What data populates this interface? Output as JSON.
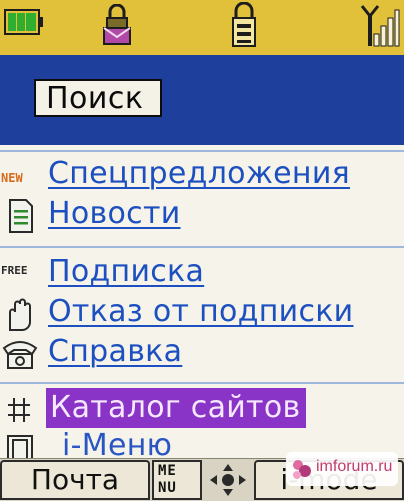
{
  "search": {
    "label": "Поиск"
  },
  "menu": {
    "items": [
      {
        "label": "Спецпредложения",
        "icon": "new-icon"
      },
      {
        "label": "Новости",
        "icon": "document-icon"
      },
      {
        "label": "Подписка",
        "icon": "free-icon"
      },
      {
        "label": "Отказ от подписки",
        "icon": "hand-icon"
      },
      {
        "label": "Справка",
        "icon": "telephone-icon"
      },
      {
        "label": "Каталог сайтов",
        "icon": "hash-icon",
        "selected": true
      },
      {
        "label": "i-Меню",
        "icon": "book-icon"
      }
    ],
    "icon_labels": {
      "new": "NEW",
      "free": "FREE"
    }
  },
  "softkeys": {
    "left": "Почта",
    "menu_glyph": [
      "ME",
      "NU"
    ],
    "right": "i-mode"
  },
  "watermark": "imforum.ru",
  "colors": {
    "status_bar": "#e2c13a",
    "title_band": "#1f3f9c",
    "link": "#1c4fc0",
    "selection": "#8a34c7",
    "battery": "#2fae2f",
    "separator": "#9fb6df"
  }
}
